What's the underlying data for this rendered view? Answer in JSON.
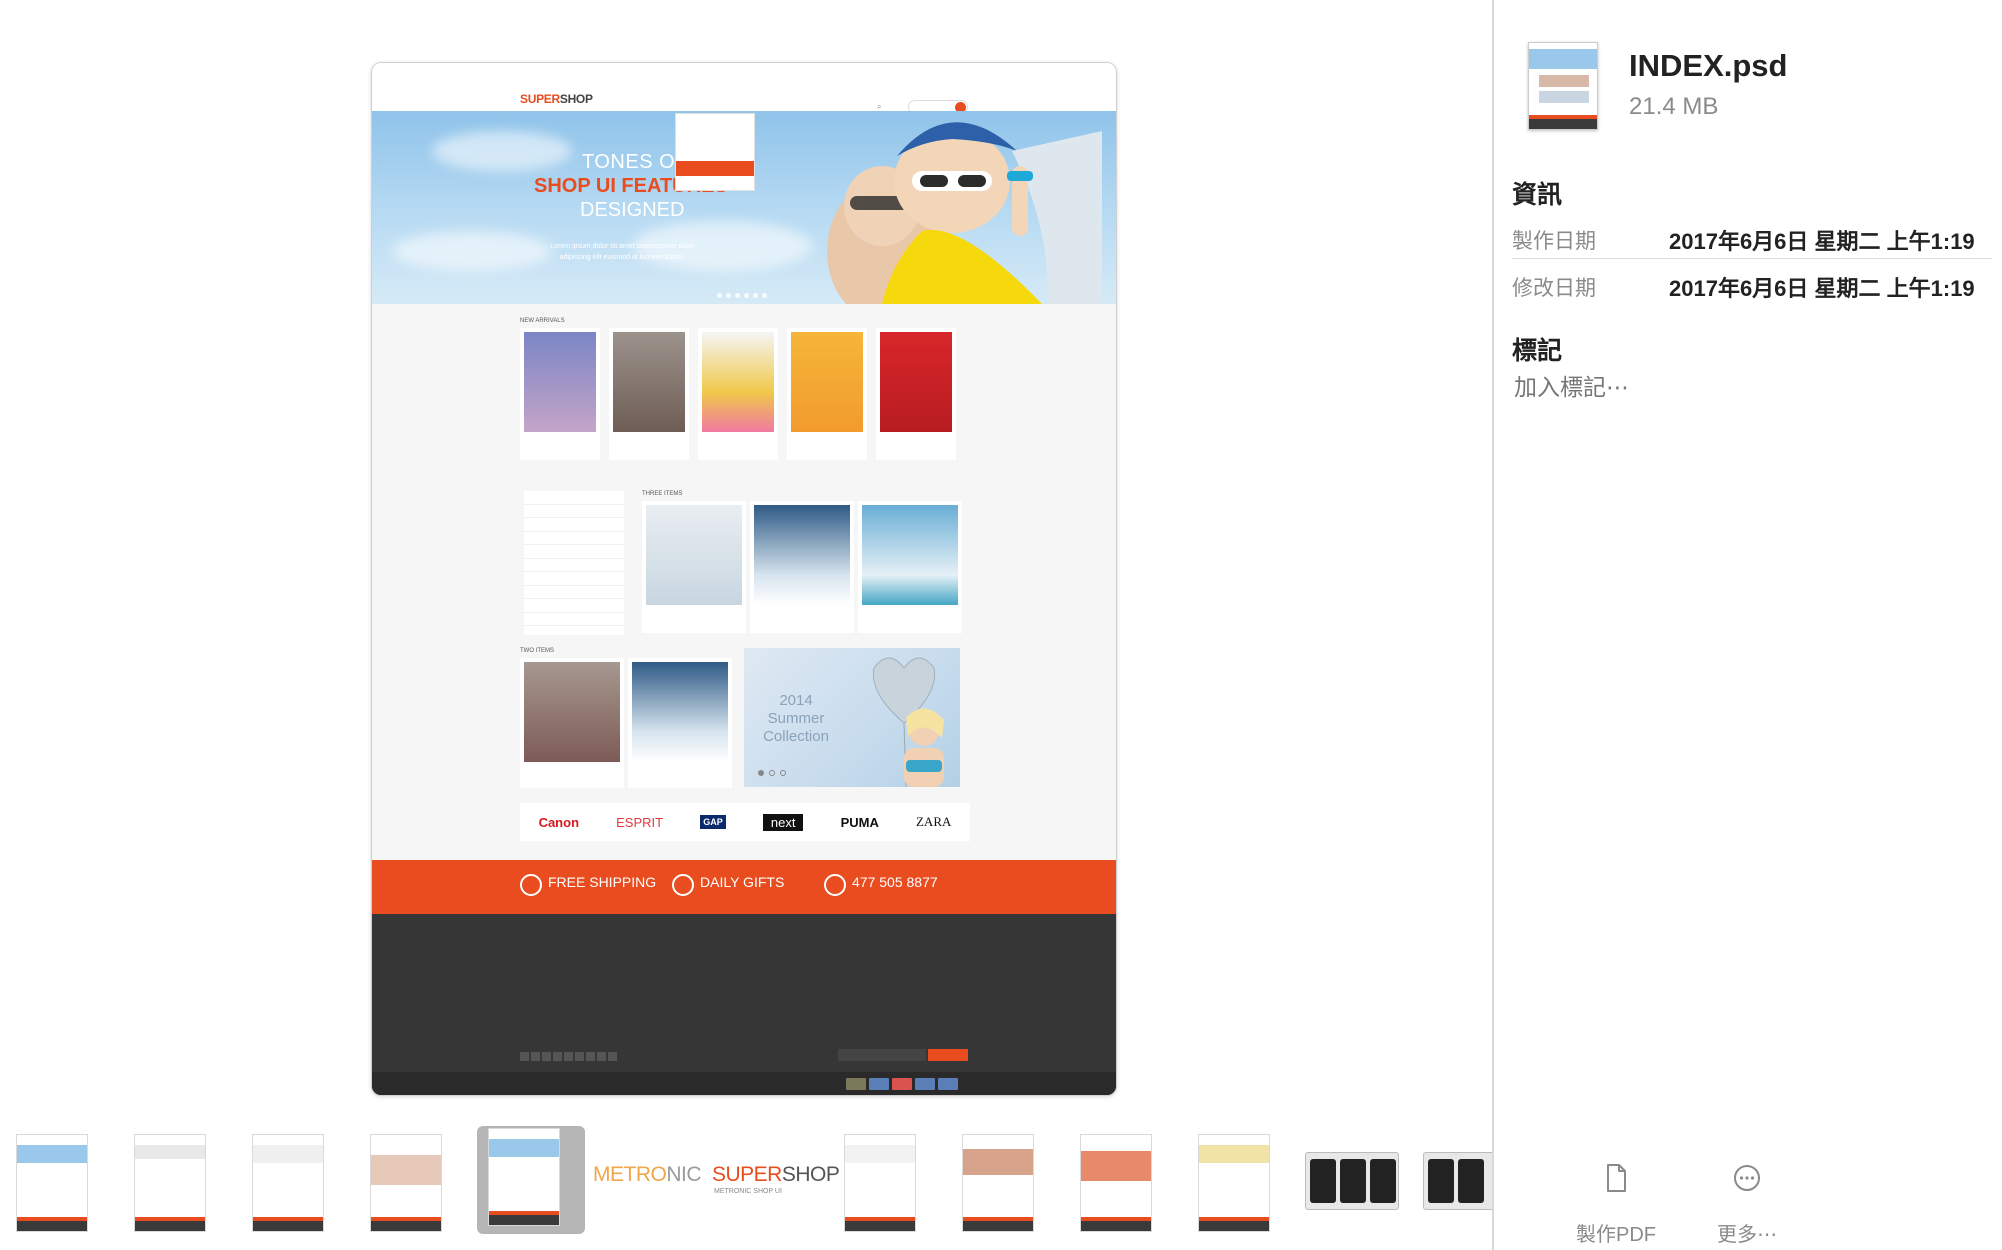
{
  "window": {
    "file_name": "INDEX.psd",
    "file_size": "21.4 MB"
  },
  "info": {
    "heading": "資訊",
    "rows": [
      {
        "label": "製作日期",
        "value": "2017年6月6日 星期二 上午1:19"
      },
      {
        "label": "修改日期",
        "value": "2017年6月6日 星期二 上午1:19"
      }
    ],
    "tags_heading": "標記",
    "tags_placeholder": "加入標記⋯"
  },
  "actions": {
    "make_pdf": "製作PDF",
    "more": "更多⋯"
  },
  "preview": {
    "logo_a": "SUPER",
    "logo_b": "SHOP",
    "hero_line1": "TONES OF",
    "hero_line2": "SHOP UI FEATURES",
    "hero_line3": "DESIGNED",
    "hero_para": "Lorem ipsum dolor sit amet consectetuer diam adipiscing elit euismod ut laoreet dolore.",
    "section_new": "NEW ARRIVALS",
    "section_three": "THREE ITEMS",
    "section_two": "TWO ITEMS",
    "promo_text": "2014 Summer Collection",
    "brands": [
      "Canon",
      "ESPRIT",
      "GAP",
      "next",
      "PUMA",
      "ZARA"
    ],
    "strip": [
      {
        "big": "FREE SHIPPING"
      },
      {
        "big": "DAILY GIFTS"
      },
      {
        "big": "477 505 8877"
      }
    ]
  },
  "thumbnails": {
    "metronic_a": "METRO",
    "metronic_b": "NIC",
    "supershop_a": "SUPER",
    "supershop_b": "SHOP",
    "supershop_sub": "METRONIC SHOP UI"
  },
  "colors": {
    "accent": "#e84c1f",
    "footer": "#363636",
    "text_primary": "#222222",
    "text_secondary": "#8a8a8a"
  },
  "icons": {
    "make_pdf": "document-icon",
    "more": "ellipsis-circle-icon"
  }
}
